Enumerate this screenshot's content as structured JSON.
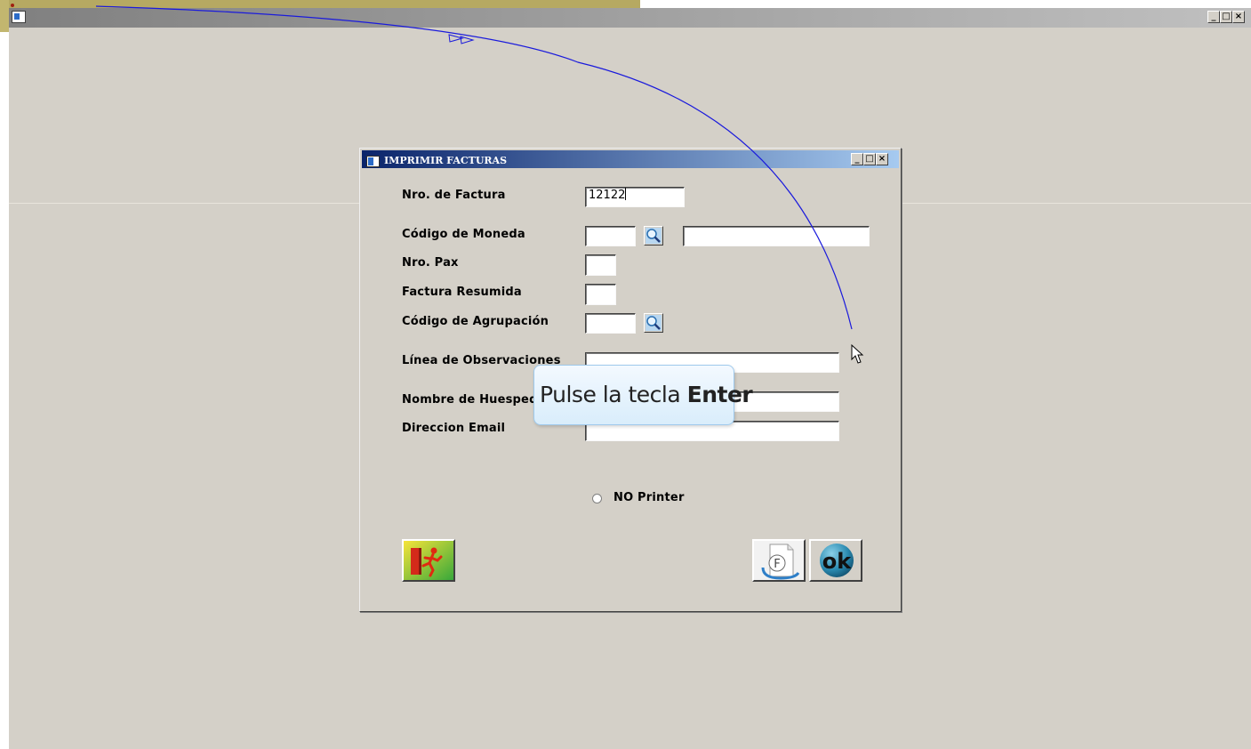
{
  "dialog": {
    "title": "IMPRIMIR FACTURAS",
    "labels": {
      "invoice_number": "Nro. de Factura",
      "currency_code": "Código de Moneda",
      "pax_number": "Nro. Pax",
      "summary_invoice": "Factura Resumida",
      "grouping_code": "Código de Agrupación",
      "observations": "Línea de Observaciones",
      "guest_name": "Nombre de Huesped",
      "email": "Direccion Email"
    },
    "values": {
      "invoice_number": "12122",
      "currency_code": "",
      "currency_description": "",
      "pax_number": "",
      "summary_invoice": "",
      "grouping_code": "",
      "observations": "",
      "guest_name": "",
      "email": ""
    },
    "radio": {
      "label": "NO Printer",
      "selected": false
    },
    "buttons": {
      "exit_icon": "exit-running-man-icon",
      "invoice_icon": "f-document-icon",
      "ok_label": "ok"
    }
  },
  "tooltip": {
    "text": "Pulse la tecla ",
    "key": "Enter"
  },
  "colors": {
    "desktop": "#d4d0c8",
    "title_active": "#0a246a",
    "title_gradient_end": "#a6caf0",
    "annotation_arrow": "#1a1adc"
  }
}
